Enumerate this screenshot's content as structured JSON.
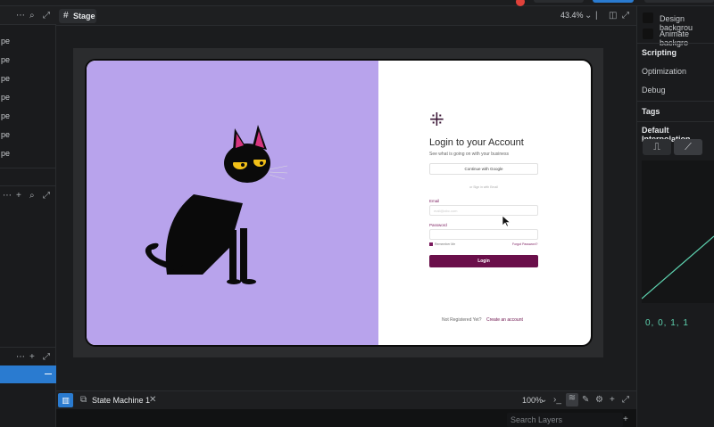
{
  "stage": {
    "tab": "Stage",
    "zoom": "43.4%"
  },
  "left_panel": {
    "items": [
      "pe",
      "pe",
      "pe",
      "pe",
      "pe",
      "pe",
      "pe"
    ]
  },
  "login": {
    "title": "Login to your Account",
    "subtitle": "See what is going on with your business",
    "google_button": "Continue with Google",
    "divider": "or Sign in with Email",
    "email_label": "Email",
    "email_placeholder": "mail@abc.com",
    "password_label": "Password",
    "remember": "Remember Me",
    "forgot": "Forgot Password?",
    "login_button": "Login",
    "not_registered": "Not Registered Yet?",
    "create_account": "Create an account"
  },
  "right_panel": {
    "design_bg": "Design backgrou",
    "animate_bg": "Animate backgro",
    "scripting": "Scripting",
    "optimization": "Optimization",
    "debug": "Debug",
    "tags": "Tags",
    "default_interp": "Default Interpolation",
    "values": "0, 0, 1, 1"
  },
  "bottom": {
    "state_machine": "State Machine 1",
    "zoom": "100%",
    "search_placeholder": "Search Layers"
  }
}
